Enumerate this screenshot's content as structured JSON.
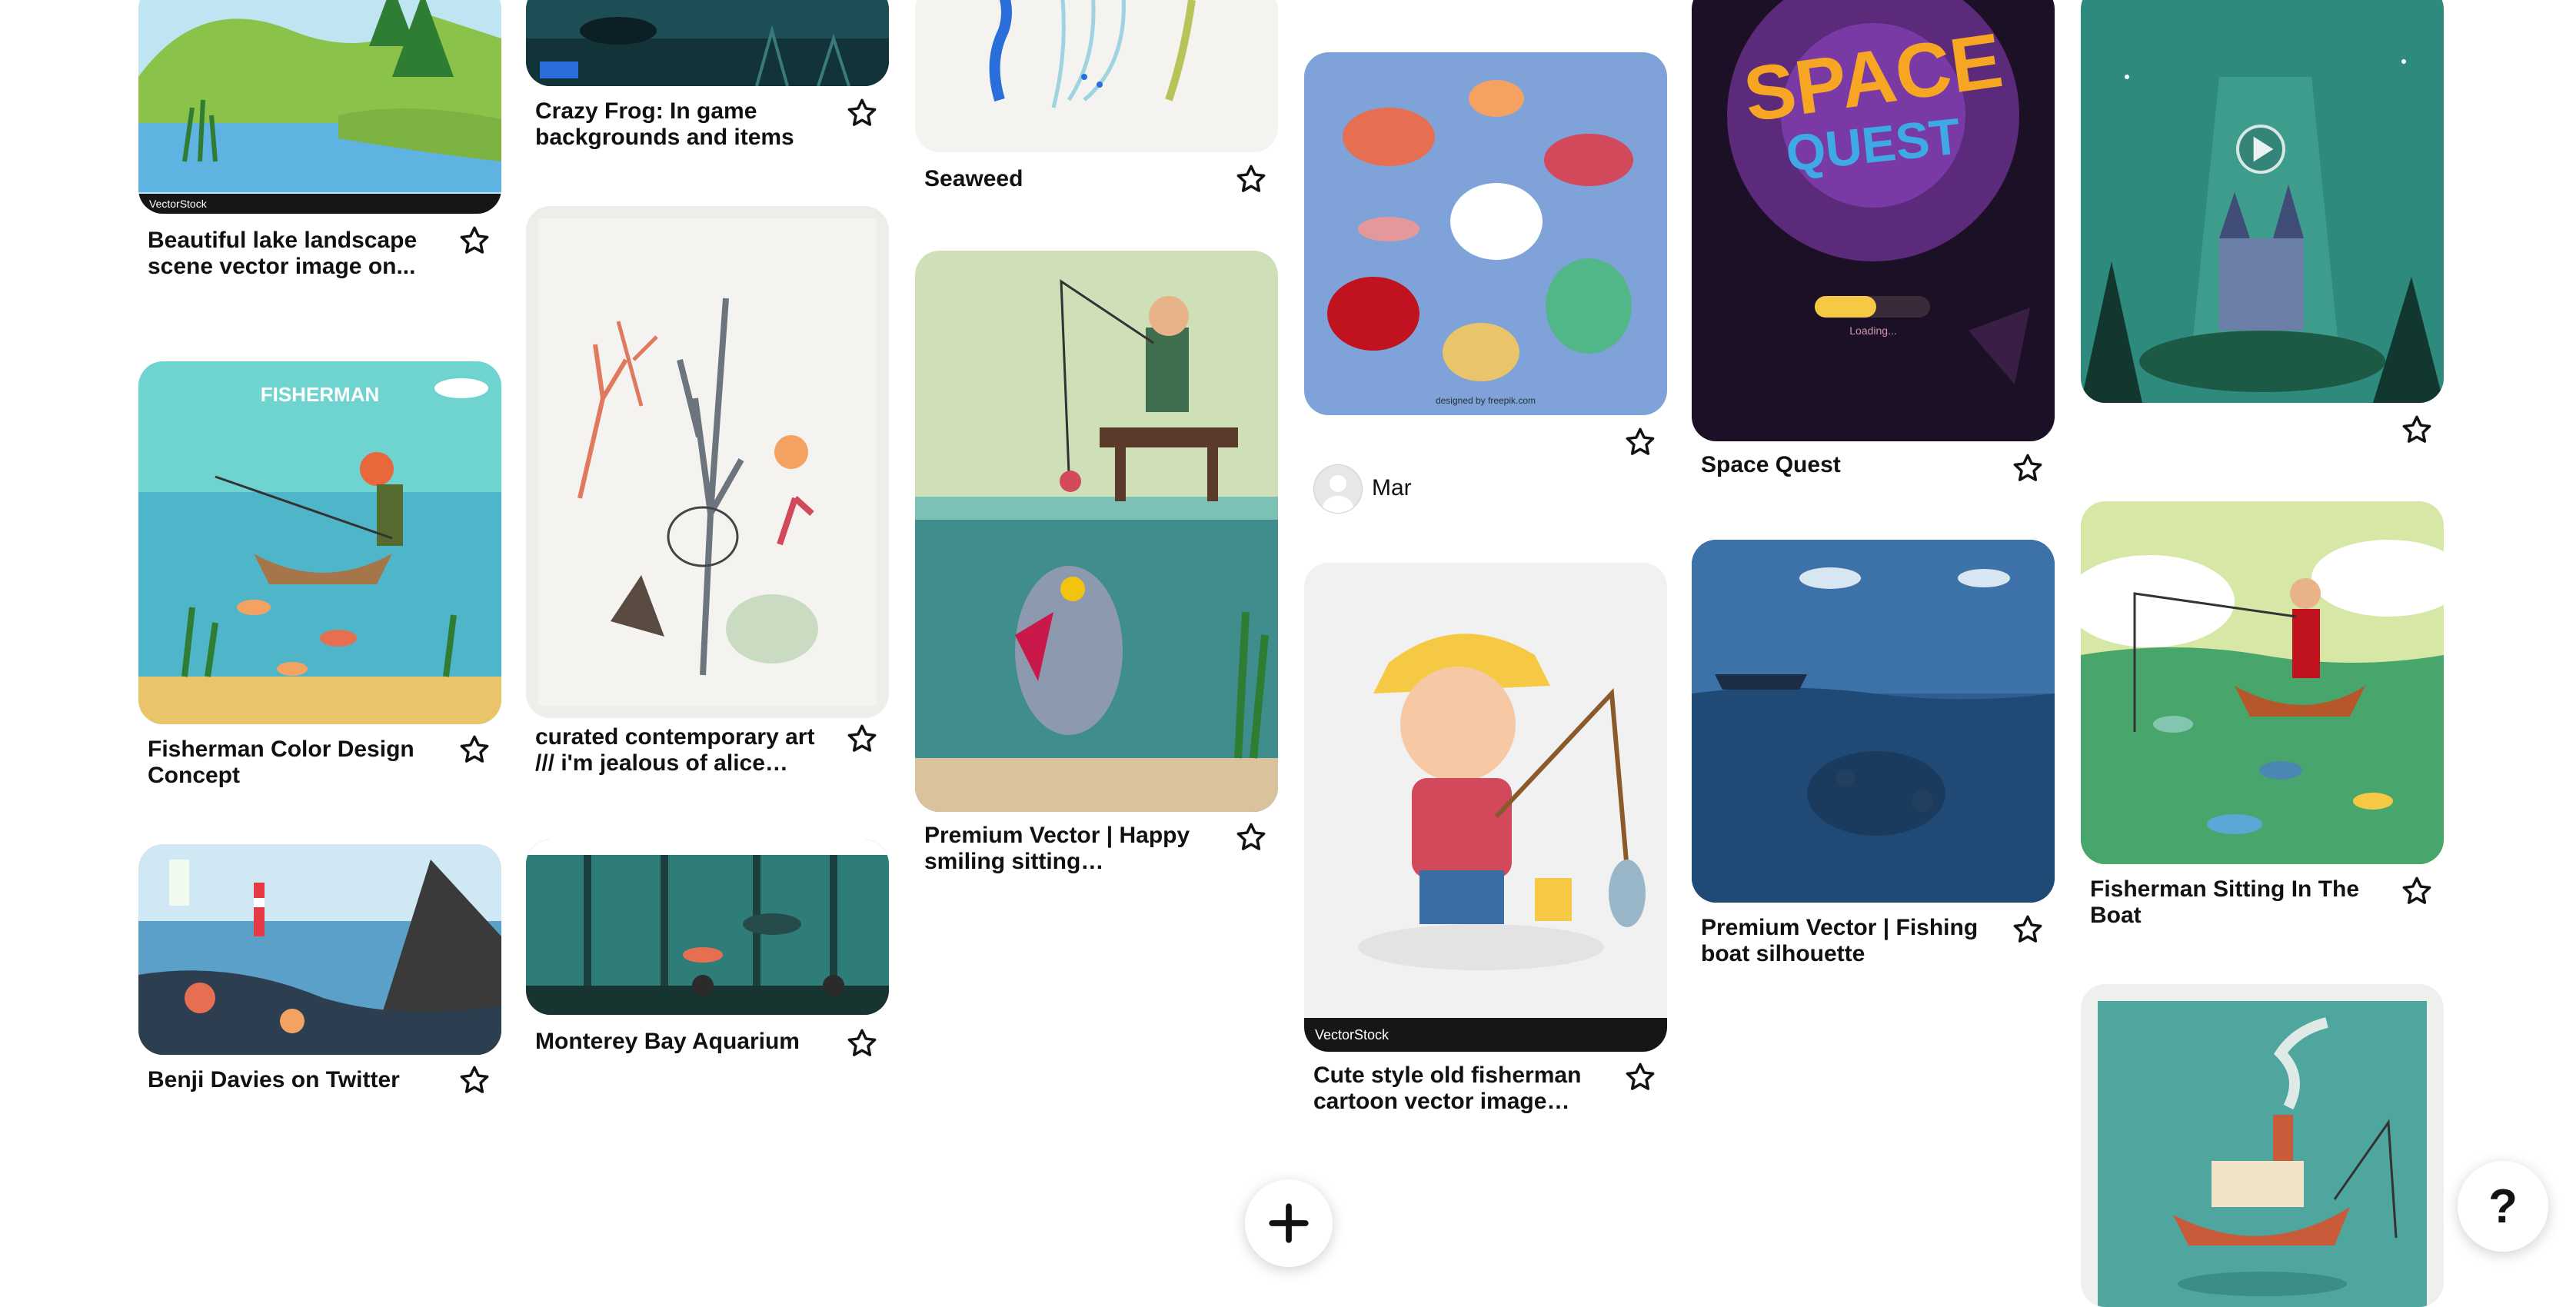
{
  "pins": [
    {
      "id": "lake",
      "caption": "Beautiful lake landscape scene vector image on...",
      "watermark": "VectorStock"
    },
    {
      "id": "fisherman-color",
      "caption": "Fisherman Color Design Concept",
      "poster_title": "FISHERMAN"
    },
    {
      "id": "benji",
      "caption": "Benji Davies on Twitter"
    },
    {
      "id": "crazy-frog",
      "caption": "Crazy Frog: In game backgrounds and items"
    },
    {
      "id": "curated",
      "caption": "curated contemporary art /// i'm jealous of alice ferrow"
    },
    {
      "id": "monterey",
      "caption": "Monterey Bay Aquarium"
    },
    {
      "id": "seaweed",
      "caption": "Seaweed"
    },
    {
      "id": "happy-fisherman",
      "caption": "Premium Vector | Happy smiling sitting fisherman..."
    },
    {
      "id": "fishes",
      "user": "Mar",
      "credit": "designed by freepik.com"
    },
    {
      "id": "cute-fisherman",
      "caption": "Cute style old fisherman cartoon vector image on...",
      "watermark": "VectorStock"
    },
    {
      "id": "space-quest",
      "caption": "Space Quest",
      "art_title_1": "SPACE",
      "art_title_2": "QUEST",
      "loading_text": "Loading..."
    },
    {
      "id": "fishing-boat",
      "caption": "Premium Vector | Fishing boat silhouette"
    },
    {
      "id": "castle"
    },
    {
      "id": "fisherman-boat",
      "caption": "Fisherman Sitting In The Boat"
    },
    {
      "id": "tugboat"
    }
  ],
  "help_label": "?",
  "colors": {
    "text": "#111111",
    "background": "#ffffff"
  }
}
